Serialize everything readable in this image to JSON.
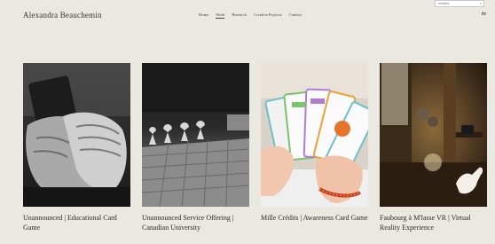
{
  "header": {
    "site_title": "Alexandra Beauchemin",
    "nav": [
      "Home",
      "Work",
      "Research",
      "Creative Projects",
      "Contact"
    ],
    "active_nav": "Work",
    "social": "in"
  },
  "popup": {
    "text": "available",
    "close": "×"
  },
  "projects": [
    {
      "title": "Unannounced | Educational Card Game"
    },
    {
      "title": "Unannounced Service Offering | Canadian University"
    },
    {
      "title": "Mille Crédits | Awareness Card Game"
    },
    {
      "title": "Faubourg à M'lasse VR | Virtual Reality Experience"
    }
  ]
}
